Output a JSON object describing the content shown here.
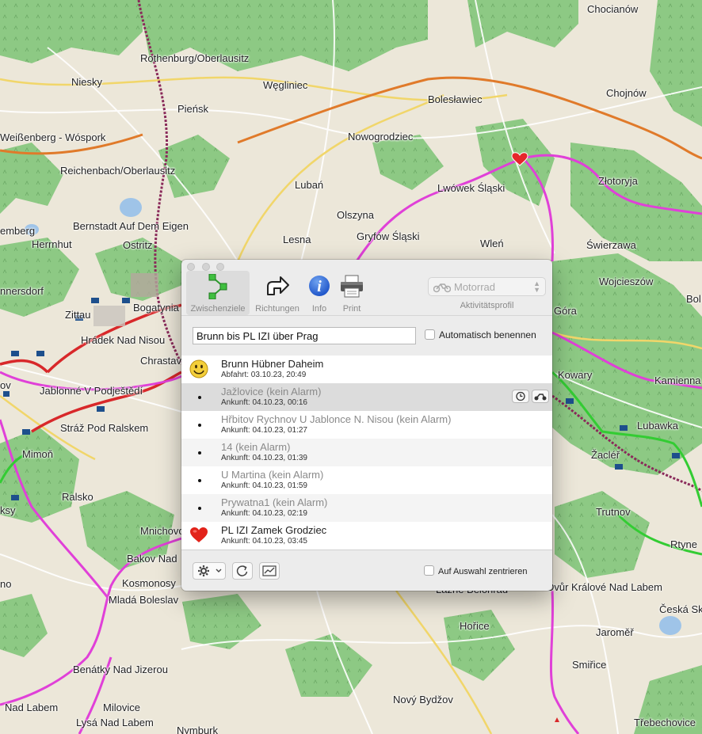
{
  "map": {
    "labels": [
      "Chocianów",
      "Rothenburg/Oberlausitz",
      "Niesky",
      "Węgliniec",
      "Chojnów",
      "Bolesławiec",
      "Pieńsk",
      "Weißenberg - Wóspork",
      "Nowogrodziec",
      "Reichenbach/Oberlausitz",
      "Złotoryja",
      "Lwówek Śląski",
      "Lubań",
      "Bernstadt Auf Dem Eigen",
      "Olszyna",
      "emberg",
      "Herrnhut",
      "Gryfów Śląski",
      "Świerzawa",
      "Lesna",
      "Ostritz",
      "Wleń",
      "Wojcieszów",
      "nnersdorf",
      "Bogatynia",
      "Góra",
      "Bol",
      "Zittau",
      "Hrádek Nad Nisou",
      "Chrastava",
      "Kowary",
      "Kamienna",
      "ov",
      "Jablonné V Podještědí",
      "Lubawka",
      "Stráž Pod Ralskem",
      "Žacléř",
      "Mimoň",
      "Ralsko",
      "Trutnov",
      "ksy",
      "Mnichovo",
      "Rtyne",
      "no",
      "Bakov Nad",
      "Kosmonosy",
      "Dvůr Králové Nad Labem",
      "Mladá Boleslav",
      "Česká Sk",
      "Hořice",
      "Jaroměř",
      "Benátky Nad Jizerou",
      "Smiřice",
      "Nad Labem",
      "Milovice",
      "Nový Bydžov",
      "Lysá Nad Labem",
      "Třebechovice",
      "Nymburk",
      "Lázně Bělohrad"
    ]
  },
  "window": {
    "toolbar": {
      "items": [
        {
          "label": "Zwischenziele",
          "icon": "waypoints-icon",
          "active": true
        },
        {
          "label": "Richtungen",
          "icon": "directions-arrow-icon",
          "active": false
        },
        {
          "label": "Info",
          "icon": "info-icon",
          "active": false
        },
        {
          "label": "Print",
          "icon": "printer-icon",
          "active": false
        }
      ],
      "profile": {
        "value": "Motorrad",
        "icon": "motorcycle-icon",
        "caption": "Aktivitätsprofil"
      }
    },
    "name_field": {
      "value": "Brunn bis PL IZI über Prag"
    },
    "auto_name": {
      "label": "Automatisch benennen",
      "checked": false
    },
    "waypoints": [
      {
        "title": "Brunn Hübner Daheim",
        "sub": "Abfahrt: 03.10.23, 20:49",
        "icon": "smiley-icon",
        "dim": false
      },
      {
        "title": "Jažlovice (kein Alarm)",
        "sub": "Ankunft: 04.10.23, 00:16",
        "icon": "dot",
        "dim": true
      },
      {
        "title": "Hřbitov Rychnov U Jablonce N. Nisou (kein Alarm)",
        "sub": "Ankunft: 04.10.23, 01:27",
        "icon": "dot",
        "dim": true
      },
      {
        "title": "14 (kein Alarm)",
        "sub": "Ankunft: 04.10.23, 01:39",
        "icon": "dot",
        "dim": true
      },
      {
        "title": "U Martina (kein Alarm)",
        "sub": "Ankunft: 04.10.23, 01:59",
        "icon": "dot",
        "dim": true
      },
      {
        "title": "Prywatna1 (kein Alarm)",
        "sub": "Ankunft: 04.10.23, 02:19",
        "icon": "dot",
        "dim": true
      },
      {
        "title": "PL IZI Zamek Grodziec",
        "sub": "Ankunft: 04.10.23, 03:45",
        "icon": "heart-icon",
        "dim": false
      }
    ],
    "center_on_selection": {
      "label": "Auf Auswahl zentrieren",
      "checked": false
    }
  },
  "colors": {
    "route": "#e040d8",
    "road_red": "#d8282a",
    "road_orange": "#e07a2a",
    "green_track": "#33cc33",
    "forest": "#7ec27a",
    "accent_blue": "#2166d6"
  }
}
